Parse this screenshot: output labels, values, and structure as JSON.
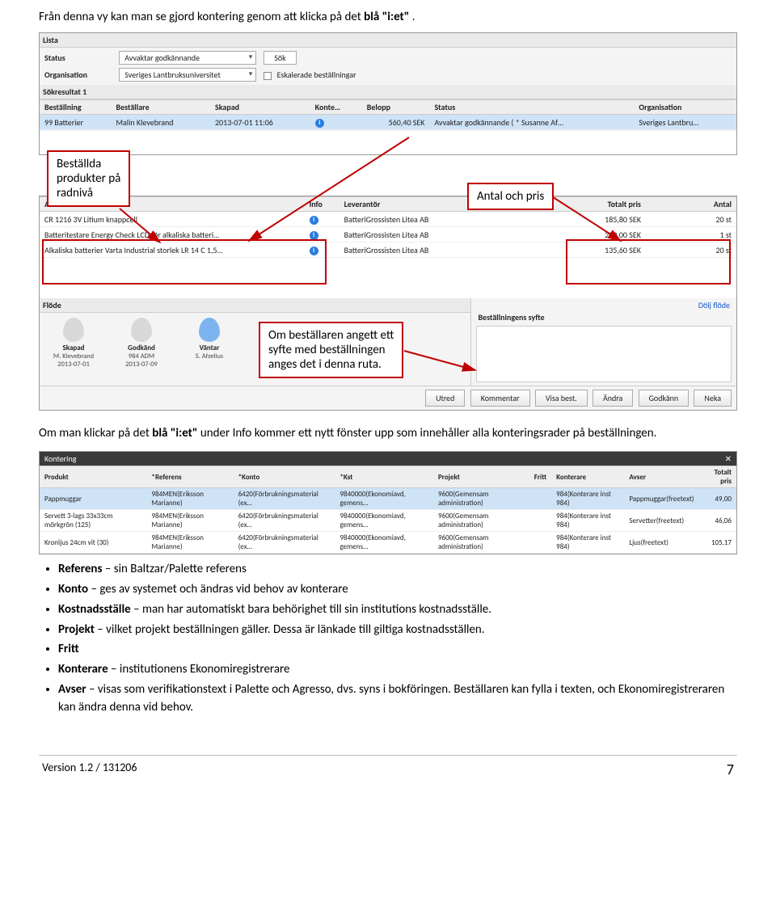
{
  "intro": {
    "prefix": "Från denna vy kan man se gjord kontering genom att klicka på det ",
    "bold": "blå \"i:et\"",
    "suffix": "."
  },
  "callouts": {
    "products": "Beställda\nprodukter på\nradnivå",
    "price": "Antal och pris",
    "syfte": "Om beställaren angett ett\nsyfte med beställningen\nanges det i denna ruta."
  },
  "panel1": {
    "title": "Lista",
    "status_label": "Status",
    "status_value": "Avvaktar godkännande",
    "sok": "Sök",
    "org_label": "Organisation",
    "org_value": "Sveriges Lantbruksuniversitet",
    "escalate": "Eskalerade beställningar",
    "result_label": "Sökresultat 1",
    "cols": [
      "Beställning",
      "Beställare",
      "Skapad",
      "Konte…",
      "Belopp",
      "Status",
      "Organisation"
    ],
    "row": {
      "bestallning": "99 Batterier",
      "bestallare": "Malin Klevebrand",
      "skapad": "2013-07-01 11:06",
      "belopp": "560,40 SEK",
      "status": "Avvaktar godkännande ( * Susanne Af…",
      "org": "Sveriges Lantbru…"
    }
  },
  "panel2": {
    "cols": [
      "Artikel",
      "Info",
      "Leverantör",
      "Totalt pris",
      "Antal"
    ],
    "rows": [
      {
        "art": "CR 1216 3V Litium knappcell",
        "lev": "BatteriGrossisten Litea AB",
        "pris": "185,80 SEK",
        "antal": "20 st"
      },
      {
        "art": "Batteritestare Energy Check LCD för alkaliska batteri…",
        "lev": "BatteriGrossisten Litea AB",
        "pris": "239,00 SEK",
        "antal": "1 st"
      },
      {
        "art": "Alkaliska batterier Varta Industrial storlek LR 14 C 1,5…",
        "lev": "BatteriGrossisten Litea AB",
        "pris": "135,60 SEK",
        "antal": "20 st"
      }
    ],
    "flode_label": "Flöde",
    "dolj": "Dölj flöde",
    "syfte_label": "Beställningens syfte",
    "flode_steps": [
      {
        "name": "Skapad",
        "sub1": "M. Klevebrand",
        "sub2": "2013-07-01"
      },
      {
        "name": "Godkänd",
        "sub1": "984 ADM",
        "sub2": "2013-07-09"
      },
      {
        "name": "Väntar",
        "sub1": "S. Afzelius",
        "sub2": ""
      }
    ],
    "buttons": [
      "Utred",
      "Kommentar",
      "Visa best.",
      "Ändra",
      "Godkänn",
      "Neka"
    ]
  },
  "midtext": {
    "p1a": "Om man klickar på det ",
    "p1b": "blå \"i:et\"",
    "p1c": " under Info kommer ett nytt fönster upp som innehåller alla konteringsrader på beställningen."
  },
  "panel3": {
    "title": "Kontering",
    "cols": [
      "Produkt",
      "*Referens",
      "*Konto",
      "*Kst",
      "Projekt",
      "Fritt",
      "Konterare",
      "Avser",
      "Totalt pris"
    ],
    "rows": [
      {
        "p": "Pappmuggar",
        "r": "984MEN(Eriksson Marianne)",
        "k": "6420(Förbrukningsmaterial (ex…",
        "kst": "9840000(Ekonomiavd, gemens…",
        "pr": "9600(Gemensam administration)",
        "f": "",
        "ko": "984(Konterare inst 984)",
        "a": "Pappmuggar(freetext)",
        "t": "49,00"
      },
      {
        "p": "Servett 3-lags 33x33cm mörkgrön (125)",
        "r": "984MEN(Eriksson Marianne)",
        "k": "6420(Förbrukningsmaterial (ex…",
        "kst": "9840000(Ekonomiavd, gemens…",
        "pr": "9600(Gemensam administration)",
        "f": "",
        "ko": "984(Konterare inst 984)",
        "a": "Servetter(freetext)",
        "t": "46,06"
      },
      {
        "p": "Kronljus 24cm vit (30)",
        "r": "984MEN(Eriksson Marianne)",
        "k": "6420(Förbrukningsmaterial (ex…",
        "kst": "9840000(Ekonomiavd, gemens…",
        "pr": "9600(Gemensam administration)",
        "f": "",
        "ko": "984(Konterare inst 984)",
        "a": "Ljus(freetext)",
        "t": "105,17"
      }
    ]
  },
  "bullets": [
    {
      "b": "Referens",
      "t": " – sin Baltzar/Palette referens"
    },
    {
      "b": "Konto",
      "t": " – ges av systemet och ändras vid behov av konterare"
    },
    {
      "b": "Kostnadsställe",
      "t": " – man har automatiskt bara behörighet till sin institutions kostnadsställe."
    },
    {
      "b": "Projekt",
      "t": " – vilket projekt beställningen gäller. Dessa är länkade till giltiga kostnadsställen."
    },
    {
      "b": "Fritt",
      "t": ""
    },
    {
      "b": "Konterare",
      "t": " – institutionens Ekonomiregistrerare"
    },
    {
      "b": "Avser",
      "t": " – visas som verifikationstext i Palette och Agresso, dvs. syns i bokföringen. Beställaren kan fylla i texten, och Ekonomiregistreraren kan ändra denna vid behov."
    }
  ],
  "footer": {
    "left": "Version 1.2 / 131206",
    "right": "7"
  }
}
